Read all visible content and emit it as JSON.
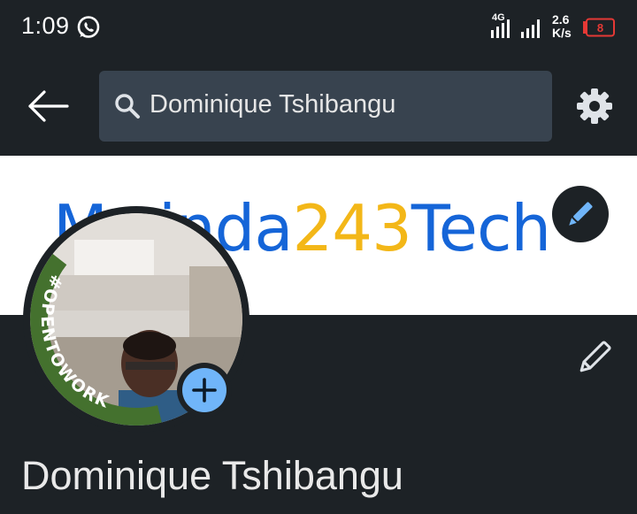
{
  "status_bar": {
    "time": "1:09",
    "network_type": "4G",
    "speed_value": "2.6",
    "speed_unit": "K/s",
    "battery_level": "8",
    "icons": [
      "whatsapp-icon",
      "signal-icon",
      "signal-icon",
      "battery-icon"
    ]
  },
  "app_bar": {
    "back_icon": "arrow-left-icon",
    "search_value": "Dominique Tshibangu",
    "settings_icon": "gear-icon"
  },
  "banner": {
    "text_part1": "Mwinda",
    "text_part2": "243",
    "text_part3": "Tech",
    "edit_icon": "pencil-icon"
  },
  "profile": {
    "name": "Dominique Tshibangu",
    "open_to_work_badge": "#OPENTOWORK",
    "add_icon": "plus-icon",
    "edit_icon": "pencil-icon"
  },
  "colors": {
    "background": "#1d2226",
    "search_bg": "#38434f",
    "brand_blue": "#1565d8",
    "brand_yellow": "#f3b718",
    "open_to_work_green": "#44712e",
    "accent_blue": "#70b5f9",
    "battery_red": "#e53935"
  }
}
